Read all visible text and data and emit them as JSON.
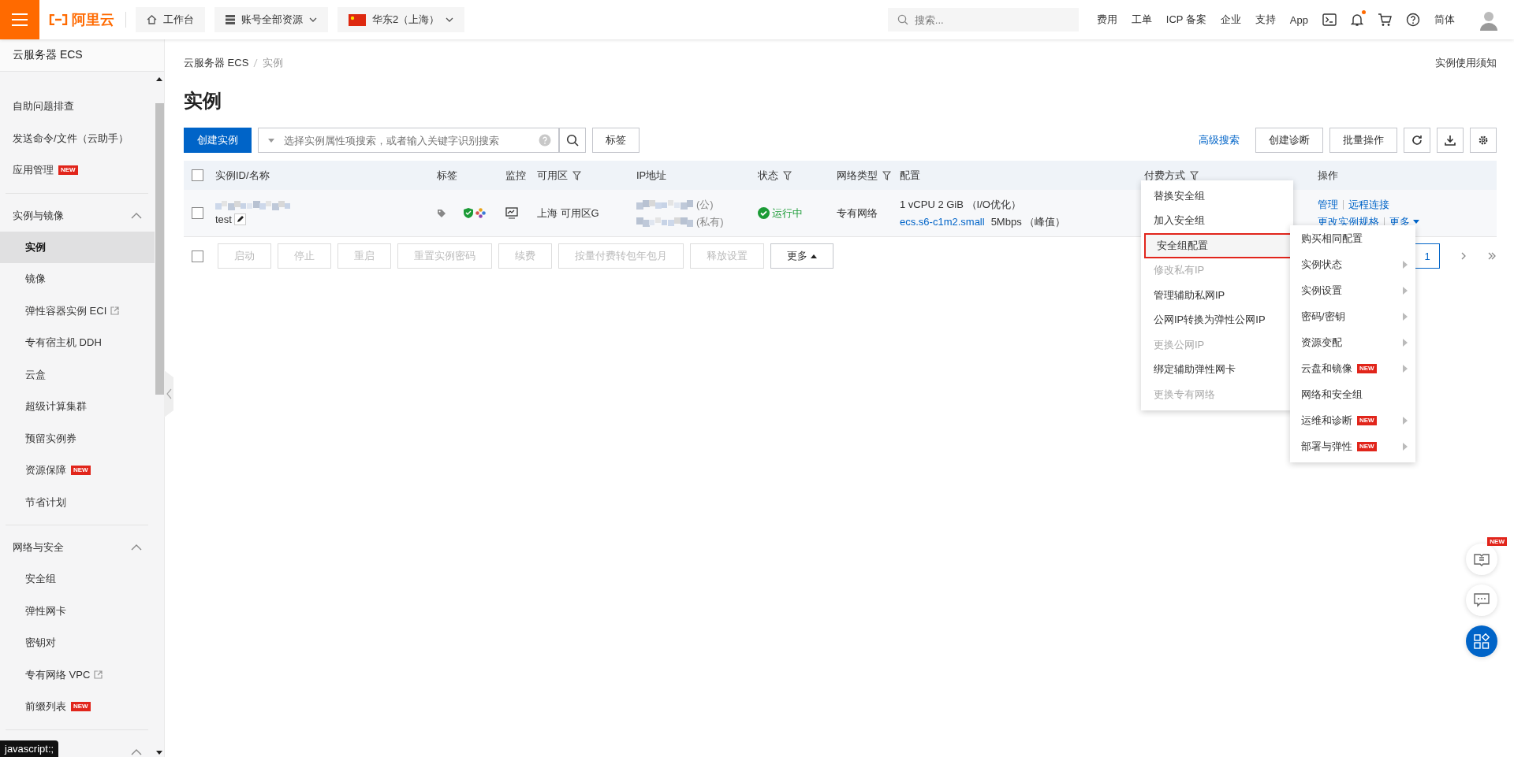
{
  "topbar": {
    "logo_text": "阿里云",
    "nav": [
      {
        "kind": "home",
        "label": "工作台"
      },
      {
        "kind": "resources",
        "label": "账号全部资源"
      },
      {
        "kind": "region",
        "label": "华东2（上海）"
      }
    ],
    "search": {
      "placeholder": "搜索..."
    },
    "links": [
      "费用",
      "工单",
      "ICP 备案",
      "企业",
      "支持",
      "App"
    ],
    "notification": true,
    "language": "简体"
  },
  "sidebar": {
    "title": "云服务器 ECS",
    "links": [
      {
        "label": "自助问题排查",
        "selected": false
      },
      {
        "label": "发送命令/文件（云助手）",
        "selected": false
      },
      {
        "label": "应用管理",
        "new": "NEW",
        "selected": false
      }
    ],
    "groups": [
      {
        "label": "实例与镜像",
        "expanded": true,
        "children": [
          {
            "label": "实例",
            "selected": true
          },
          {
            "label": "镜像",
            "selected": false
          },
          {
            "label": "弹性容器实例 ECI",
            "external": true,
            "selected": false
          },
          {
            "label": "专有宿主机 DDH",
            "selected": false
          },
          {
            "label": "云盒",
            "selected": false
          },
          {
            "label": "超级计算集群",
            "selected": false
          },
          {
            "label": "预留实例券",
            "selected": false
          },
          {
            "label": "资源保障",
            "new": "NEW",
            "selected": false
          },
          {
            "label": "节省计划",
            "selected": false
          }
        ]
      },
      {
        "label": "网络与安全",
        "expanded": true,
        "children": [
          {
            "label": "安全组",
            "selected": false
          },
          {
            "label": "弹性网卡",
            "selected": false
          },
          {
            "label": "密钥对",
            "selected": false
          },
          {
            "label": "专有网络 VPC",
            "external": true,
            "selected": false
          },
          {
            "label": "前缀列表",
            "new": "NEW",
            "selected": false
          }
        ]
      },
      {
        "expanded": true
      }
    ]
  },
  "breadcrumb": [
    "云服务器 ECS",
    "实例"
  ],
  "notice_link": "实例使用须知",
  "page_title": "实例",
  "toolbar": {
    "create": "创建实例",
    "search_placeholder": "选择实例属性项搜索，或者输入关键字识别搜索",
    "tag_button": "标签",
    "advanced_search": "高级搜索",
    "buttons": [
      "创建诊断",
      "批量操作"
    ]
  },
  "table": {
    "header_checked": false,
    "columns": [
      {
        "label": "实例ID/名称"
      },
      {
        "label": "标签"
      },
      {
        "label": "监控"
      },
      {
        "label": "可用区",
        "filter": true
      },
      {
        "label": "IP地址"
      },
      {
        "label": "状态",
        "filter": true
      },
      {
        "label": "网络类型",
        "filter": true
      },
      {
        "label": "配置"
      },
      {
        "label": "付费方式",
        "filter": true
      },
      {
        "label": "操作"
      }
    ],
    "rows": [
      {
        "checked": false,
        "name": "test",
        "zone": "上海 可用区G",
        "ip_public_suffix": "(公)",
        "ip_private_suffix": "(私有)",
        "status": "运行中",
        "network": "专有网络",
        "config": "1 vCPU 2 GiB （I/O优化）",
        "spec": "ecs.s6-c1m2.small",
        "bandwidth": "5Mbps （峰值）",
        "actions": [
          "管理",
          "远程连接",
          "更改实例规格",
          "更多"
        ]
      }
    ]
  },
  "batch": {
    "checked": false,
    "buttons": [
      {
        "label": "启动",
        "disabled": true
      },
      {
        "label": "停止",
        "disabled": true
      },
      {
        "label": "重启",
        "disabled": true
      },
      {
        "label": "重置实例密码",
        "disabled": true
      },
      {
        "label": "续费",
        "disabled": true
      },
      {
        "label": "按量付费转包年包月",
        "disabled": true
      },
      {
        "label": "释放设置",
        "disabled": true
      },
      {
        "label": "更多",
        "disabled": false
      }
    ]
  },
  "pagination": [
    {
      "label": "1",
      "selected": true
    }
  ],
  "menu_network": [
    {
      "label": "替换安全组",
      "disabled": false,
      "selected": false
    },
    {
      "label": "加入安全组",
      "disabled": false,
      "selected": false
    },
    {
      "label": "安全组配置",
      "disabled": false,
      "selected": true
    },
    {
      "label": "修改私有IP",
      "disabled": true,
      "selected": false
    },
    {
      "label": "管理辅助私网IP",
      "disabled": false,
      "selected": false
    },
    {
      "label": "公网IP转换为弹性公网IP",
      "disabled": false,
      "selected": false
    },
    {
      "label": "更换公网IP",
      "disabled": true,
      "selected": false
    },
    {
      "label": "绑定辅助弹性网卡",
      "disabled": false,
      "selected": false
    },
    {
      "label": "更换专有网络",
      "disabled": true,
      "selected": false
    }
  ],
  "menu_more": [
    {
      "label": "购买相同配置",
      "submenu": false
    },
    {
      "label": "实例状态",
      "submenu": true
    },
    {
      "label": "实例设置",
      "submenu": true
    },
    {
      "label": "密码/密钥",
      "submenu": true
    },
    {
      "label": "资源变配",
      "submenu": true
    },
    {
      "label": "云盘和镜像",
      "submenu": true,
      "new": "NEW"
    },
    {
      "label": "网络和安全组",
      "submenu": false
    },
    {
      "label": "运维和诊断",
      "submenu": true,
      "new": "NEW"
    },
    {
      "label": "部署与弹性",
      "submenu": true,
      "new": "NEW"
    }
  ],
  "float_buttons": [
    {
      "kind": "docs",
      "new": "NEW"
    },
    {
      "kind": "chat"
    },
    {
      "kind": "apps"
    }
  ],
  "status_tooltip": "javascript:;"
}
